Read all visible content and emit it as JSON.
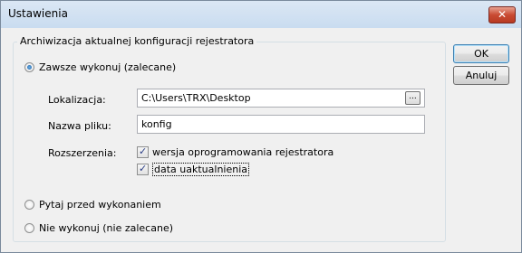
{
  "window": {
    "title": "Ustawienia",
    "close_glyph": "✕"
  },
  "group": {
    "title": "Archiwizacja aktualnej konfiguracji rejestratora",
    "options": [
      {
        "label": "Zawsze wykonuj (zalecane)",
        "checked": true
      },
      {
        "label": "Pytaj przed wykonaniem",
        "checked": false
      },
      {
        "label": "Nie wykonuj (nie zalecane)",
        "checked": false
      }
    ],
    "location": {
      "label": "Lokalizacja:",
      "value": "C:\\Users\\TRX\\Desktop",
      "browse_label": "..."
    },
    "filename": {
      "label": "Nazwa pliku:",
      "value": "konfig"
    },
    "extensions": {
      "label": "Rozszerzenia:",
      "items": [
        {
          "label": "wersja oprogramowania rejestratora",
          "checked": true
        },
        {
          "label": "data uaktualnienia",
          "checked": true
        }
      ]
    }
  },
  "buttons": {
    "ok": "OK",
    "cancel": "Anuluj"
  },
  "colors": {
    "titlebar": "#dbe7f4",
    "close": "#c94b33",
    "default_button_border": "#3c7fb1"
  }
}
